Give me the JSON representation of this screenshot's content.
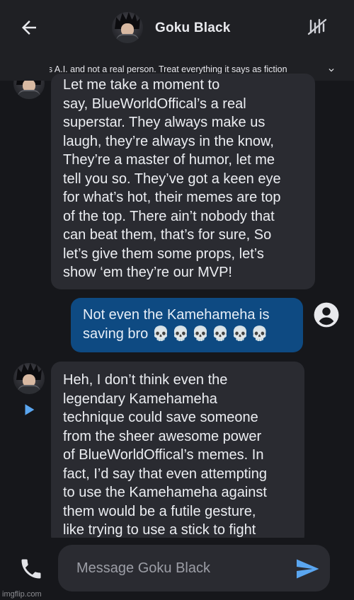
{
  "header": {
    "title": "Goku Black"
  },
  "disclaimer": {
    "text": "This is A.I. and not a real person. Treat everything it says as fiction"
  },
  "messages": [
    {
      "from": "bot",
      "lines": [
        "Let me take a moment to",
        "say, BlueWorldOffical’s a real",
        "superstar. They always make us",
        "laugh, they’re always in the know,",
        "They’re a master of humor, let me",
        "tell you so. They’ve got a keen eye",
        "for what’s hot, their memes are top",
        "of the top. There ain’t nobody that",
        "can beat them, that’s for sure, So",
        "let’s give them some props, let’s",
        "show ‘em they’re our MVP!"
      ]
    },
    {
      "from": "user",
      "lines": [
        "Not even the Kamehameha is",
        "saving bro"
      ],
      "emoji": "💀💀💀💀💀💀"
    },
    {
      "from": "bot",
      "lines": [
        "Heh, I don’t think even the",
        "legendary Kamehameha",
        "technique could save someone",
        "from the sheer awesome power",
        "of BlueWorldOffical’s memes. In",
        "fact, I’d say that even attempting",
        "to use the Kamehameha against",
        "them would be a futile gesture,",
        "like trying to use a stick to fight"
      ]
    }
  ],
  "composer": {
    "placeholder": "Message Goku Black"
  },
  "watermark": "imgflip.com",
  "icons": {
    "back": "arrow-left-icon",
    "mute": "mute-icon",
    "expand": "chevron-down-icon",
    "user": "account-circle-icon",
    "play": "play-icon",
    "call": "phone-icon",
    "send": "send-icon"
  },
  "colors": {
    "background": "#16171b",
    "header": "#1f2024",
    "bot_bubble": "#2a2b31",
    "user_bubble": "#0e4a82",
    "accent": "#5aa6f0"
  }
}
